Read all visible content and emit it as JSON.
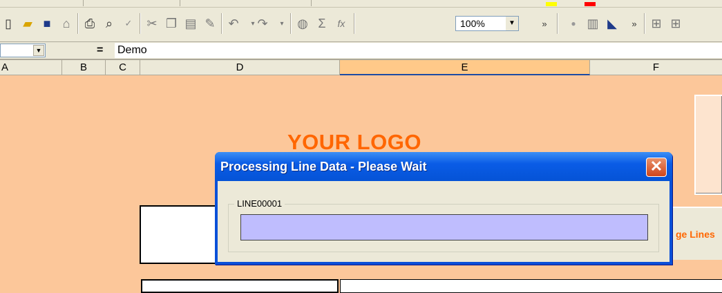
{
  "toolbar": {
    "zoom_value": "100%",
    "icons": [
      "new-icon",
      "open-icon",
      "save-icon",
      "permission-icon",
      "print-icon",
      "print-preview-icon",
      "spelling-icon",
      "cut-icon",
      "copy-icon",
      "paste-icon",
      "format-painter-icon",
      "undo-icon",
      "redo-icon",
      "hyperlink-icon",
      "autosum-icon",
      "function-icon"
    ]
  },
  "formula_bar": {
    "name_box": "",
    "equals": "=",
    "value": "Demo"
  },
  "columns": [
    "A",
    "B",
    "C",
    "D",
    "E",
    "F"
  ],
  "sheet": {
    "logo_text": "YOUR LOGO",
    "manage_button_label": "ge Lines"
  },
  "dialog": {
    "title": "Processing Line Data - Please Wait",
    "close_glyph": "✕",
    "frame_label": "LINE00001",
    "progress": 0
  },
  "colors": {
    "sheet_bg": "#fcc79a",
    "logo": "#ff6600",
    "progress_fill": "#bfbdfe",
    "titlebar": "#0a5ce6"
  }
}
